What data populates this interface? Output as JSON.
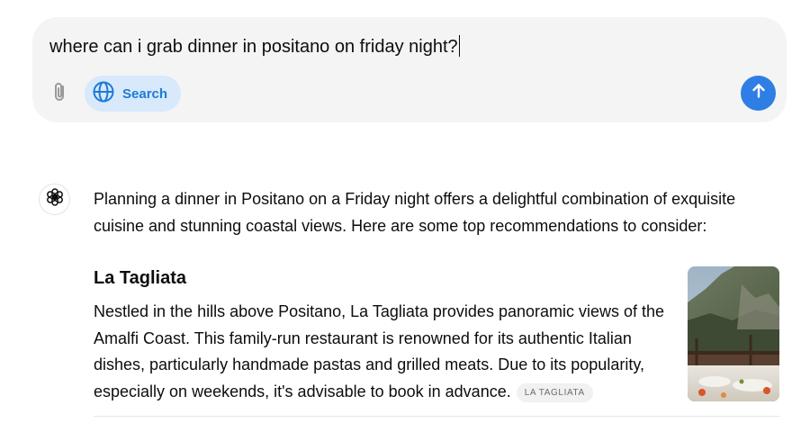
{
  "composer": {
    "input_text": "where can i grab dinner in positano on friday night?",
    "search_label": "Search",
    "icons": {
      "attach": "paperclip-icon",
      "search": "globe-icon",
      "send": "arrow-up-icon"
    },
    "colors": {
      "background": "#f4f4f4",
      "search_chip_bg": "#d7e9fb",
      "search_chip_text": "#1f7ad8",
      "send_button": "#2f7ee6"
    }
  },
  "assistant": {
    "avatar_icon": "openai-logo-icon",
    "intro": "Planning a dinner in Positano on a Friday night offers a delightful combination of exquisite cuisine and stunning coastal views. Here are some top recommendations to consider:",
    "restaurants": [
      {
        "name": "La Tagliata",
        "description": "Nestled in the hills above Positano, La Tagliata provides panoramic views of the Amalfi Coast. This family-run restaurant is renowned for its authentic Italian dishes, particularly handmade pastas and grilled meats. Due to its popularity, especially on weekends, it's advisable to book in advance.",
        "source_label": "LA TAGLIATA",
        "thumbnail": "restaurant-terrace-mountain-photo"
      }
    ]
  }
}
